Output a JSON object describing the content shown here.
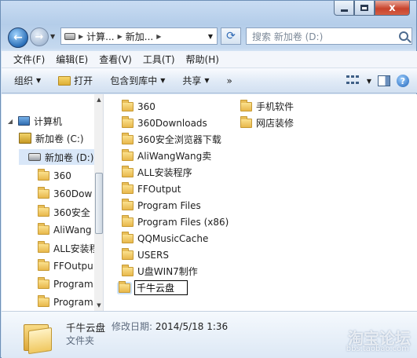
{
  "window": {
    "caption": {
      "close": "x"
    }
  },
  "nav": {
    "address_segments": [
      "计算...",
      "新加..."
    ],
    "search_placeholder": "搜索 新加卷 (D:)"
  },
  "menu": [
    "文件(F)",
    "编辑(E)",
    "查看(V)",
    "工具(T)",
    "帮助(H)"
  ],
  "toolbar": {
    "organize": "组织",
    "open": "打开",
    "include_library": "包含到库中",
    "share": "共享",
    "more": "»"
  },
  "tree": {
    "computer": "计算机",
    "drive_c": "新加卷 (C:)",
    "drive_d": "新加卷 (D:)",
    "children": [
      "360",
      "360Dow",
      "360安全",
      "AliWang",
      "ALL安装程",
      "FFOutpu",
      "Program",
      "Program"
    ]
  },
  "files": {
    "col1": [
      "360",
      "360Downloads",
      "360安全浏览器下载",
      "AliWangWang卖",
      "ALL安装程序",
      "FFOutput",
      "Program Files",
      "Program Files (x86)",
      "QQMusicCache",
      "USERS",
      "U盘WIN7制作"
    ],
    "col2": [
      "手机软件",
      "网店装修"
    ],
    "renaming": "千牛云盘"
  },
  "details": {
    "name": "千牛云盘",
    "modified_label": "修改日期:",
    "modified_value": "2014/5/18 1:36",
    "type": "文件夹"
  },
  "watermark": {
    "text": "淘宝论坛",
    "url": "bbs.taobao.com"
  }
}
